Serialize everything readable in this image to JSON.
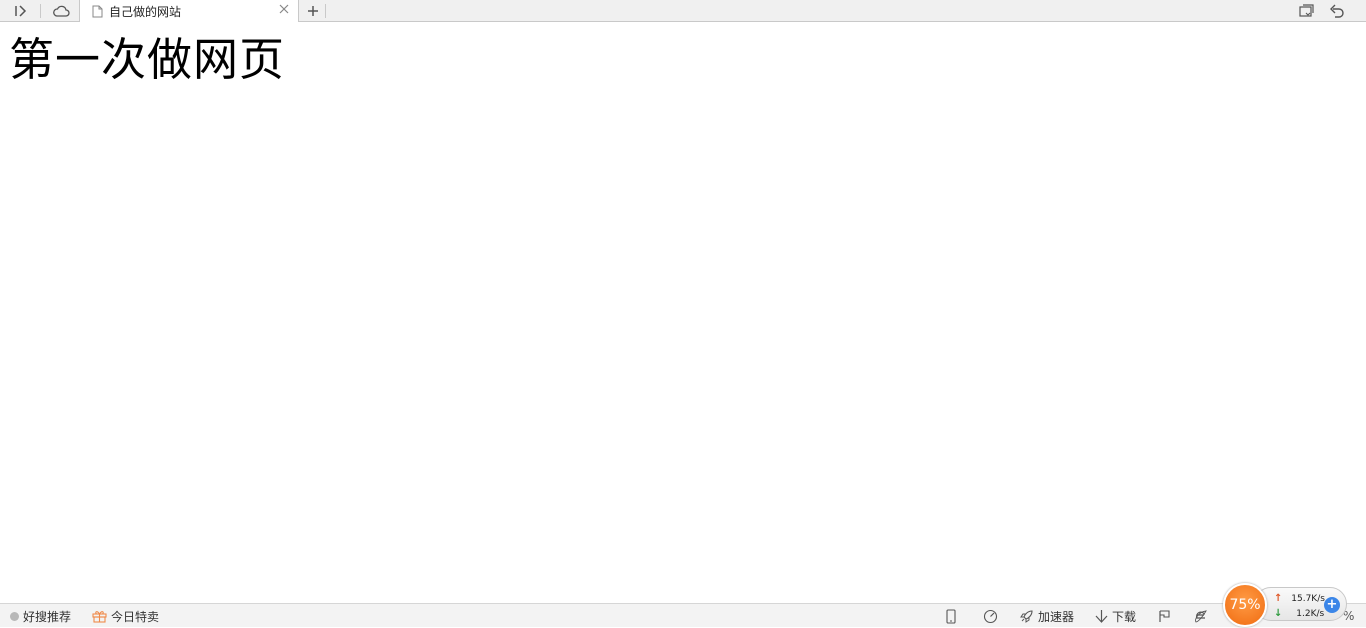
{
  "tab": {
    "title": "自己做的网站"
  },
  "page": {
    "heading": "第一次做网页"
  },
  "statusbar": {
    "recommend_label": "好搜推荐",
    "deals_label": "今日特卖",
    "accelerator_label": "加速器",
    "download_label": "下载",
    "zoom_suffix": "%"
  },
  "speed": {
    "percent": "75%",
    "upload": "15.7K/s",
    "download": "1.2K/s"
  },
  "colors": {
    "speed_circle": "#f27a1f",
    "upload_arrow": "#e05a2a",
    "download_arrow": "#2e9a3e",
    "plus_button": "#3b86e8",
    "gift_icon": "#ef8a4a"
  }
}
